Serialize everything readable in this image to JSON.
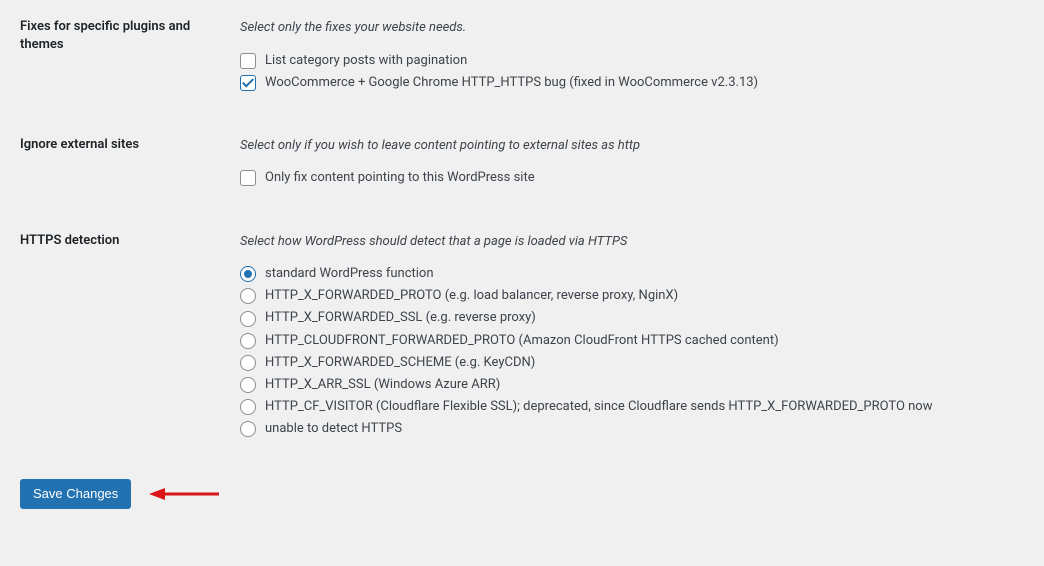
{
  "sections": {
    "fixes": {
      "heading": "Fixes for specific plugins and themes",
      "helper": "Select only the fixes your website needs.",
      "options": [
        {
          "label": "List category posts with pagination",
          "checked": false
        },
        {
          "label": "WooCommerce + Google Chrome HTTP_HTTPS bug (fixed in WooCommerce v2.3.13)",
          "checked": true
        }
      ]
    },
    "ignore": {
      "heading": "Ignore external sites",
      "helper": "Select only if you wish to leave content pointing to external sites as http",
      "options": [
        {
          "label": "Only fix content pointing to this WordPress site",
          "checked": false
        }
      ]
    },
    "detection": {
      "heading": "HTTPS detection",
      "helper": "Select how WordPress should detect that a page is loaded via HTTPS",
      "options": [
        {
          "label": "standard WordPress function",
          "selected": true
        },
        {
          "label": "HTTP_X_FORWARDED_PROTO (e.g. load balancer, reverse proxy, NginX)",
          "selected": false
        },
        {
          "label": "HTTP_X_FORWARDED_SSL (e.g. reverse proxy)",
          "selected": false
        },
        {
          "label": "HTTP_CLOUDFRONT_FORWARDED_PROTO (Amazon CloudFront HTTPS cached content)",
          "selected": false
        },
        {
          "label": "HTTP_X_FORWARDED_SCHEME (e.g. KeyCDN)",
          "selected": false
        },
        {
          "label": "HTTP_X_ARR_SSL (Windows Azure ARR)",
          "selected": false
        },
        {
          "label": "HTTP_CF_VISITOR (Cloudflare Flexible SSL); deprecated, since Cloudflare sends HTTP_X_FORWARDED_PROTO now",
          "selected": false
        },
        {
          "label": "unable to detect HTTPS",
          "selected": false
        }
      ]
    }
  },
  "buttons": {
    "save": "Save Changes"
  }
}
